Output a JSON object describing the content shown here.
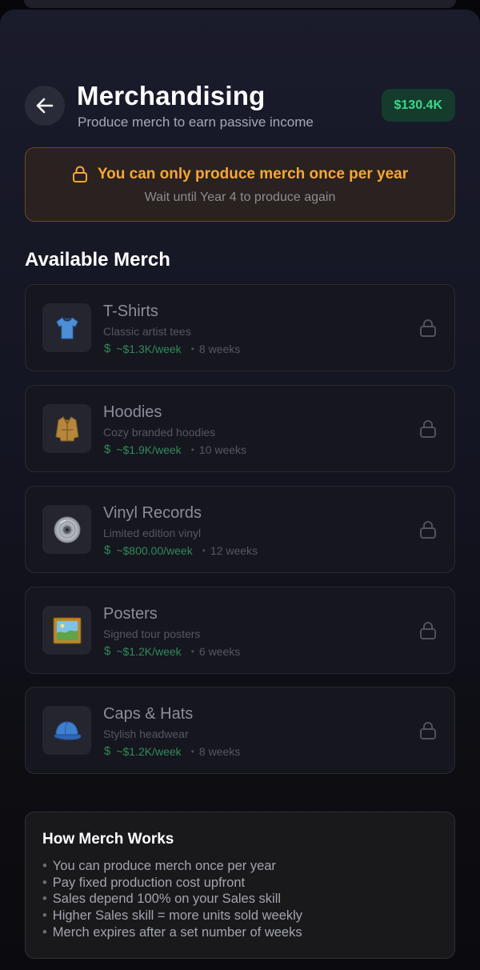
{
  "header": {
    "title": "Merchandising",
    "subtitle": "Produce merch to earn passive income",
    "balance": "$130.4K"
  },
  "warning": {
    "title": "You can only produce merch once per year",
    "subtitle": "Wait until Year 4 to produce again"
  },
  "section_title": "Available Merch",
  "merch_items": [
    {
      "name": "T-Shirts",
      "description": "Classic artist tees",
      "income": "~$1.3K/week",
      "duration": "8 weeks",
      "icon": "t-shirt-icon"
    },
    {
      "name": "Hoodies",
      "description": "Cozy branded hoodies",
      "income": "~$1.9K/week",
      "duration": "10 weeks",
      "icon": "hoodie-icon"
    },
    {
      "name": "Vinyl Records",
      "description": "Limited edition vinyl",
      "income": "~$800.00/week",
      "duration": "12 weeks",
      "icon": "vinyl-record-icon"
    },
    {
      "name": "Posters",
      "description": "Signed tour posters",
      "income": "~$1.2K/week",
      "duration": "6 weeks",
      "icon": "framed-poster-icon"
    },
    {
      "name": "Caps & Hats",
      "description": "Stylish headwear",
      "income": "~$1.2K/week",
      "duration": "8 weeks",
      "icon": "cap-icon"
    }
  ],
  "info": {
    "title": "How Merch Works",
    "items": [
      "You can produce merch once per year",
      "Pay fixed production cost upfront",
      "Sales depend 100% on your Sales skill",
      "Higher Sales skill = more units sold weekly",
      "Merch expires after a set number of weeks"
    ]
  },
  "colors": {
    "accent_green": "#38d98a",
    "warning_amber": "#f7a830",
    "income_green": "#2f8a5a"
  }
}
